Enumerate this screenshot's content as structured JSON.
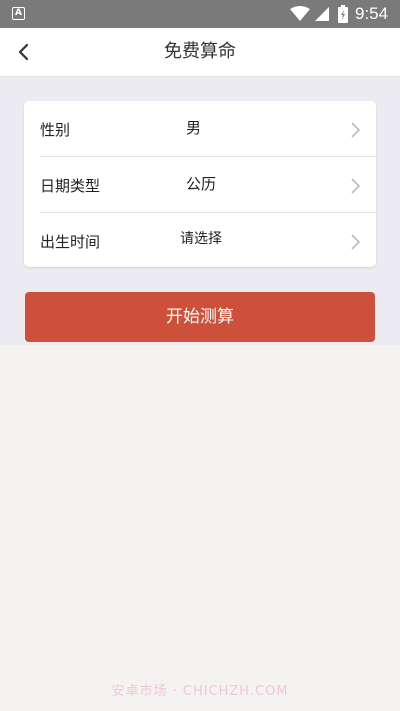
{
  "status_bar": {
    "app_icon_letter": "A",
    "time": "9:54"
  },
  "nav": {
    "title": "免费算命"
  },
  "form": {
    "rows": [
      {
        "label": "性别",
        "value": "男"
      },
      {
        "label": "日期类型",
        "value": "公历"
      },
      {
        "label": "出生时间",
        "value": "请选择"
      }
    ]
  },
  "actions": {
    "start_label": "开始测算"
  },
  "watermark": "安卓市场 · CHICHZH.COM",
  "colors": {
    "accent": "#cd513a",
    "status_bar": "#7a7a7a"
  }
}
